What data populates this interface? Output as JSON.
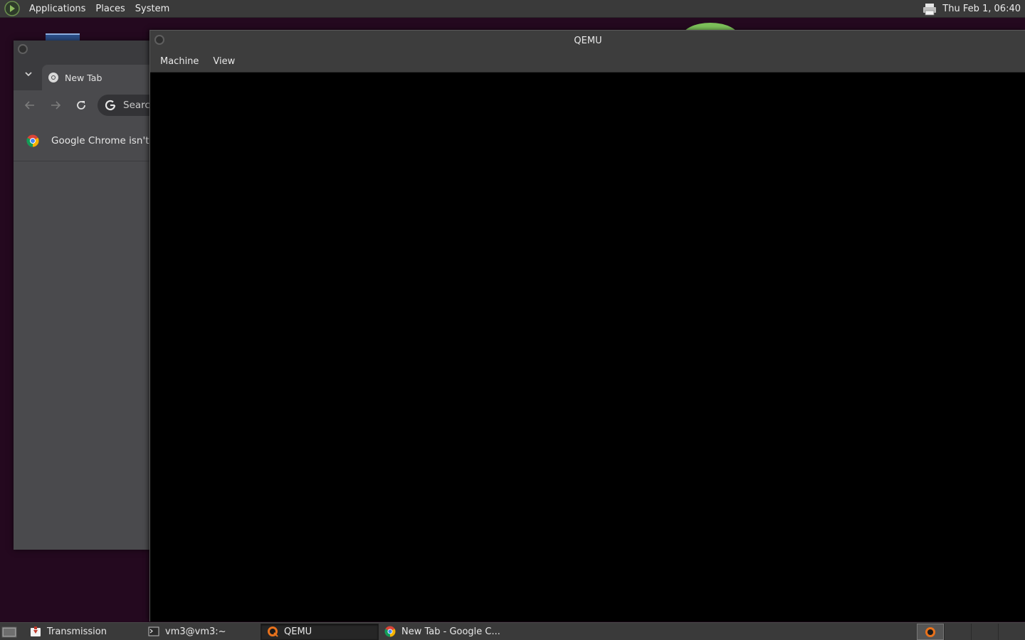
{
  "top_panel": {
    "logo_icon": "gnome-foot-icon",
    "menus": [
      "Applications",
      "Places",
      "System"
    ],
    "tray_icon": "printer-icon",
    "clock": "Thu Feb 1, 06:40"
  },
  "chrome_window": {
    "tab_title": "New Tab",
    "omnibox_text": "Search",
    "infobar_text": "Google Chrome isn't your default browser"
  },
  "qemu_window": {
    "title": "QEMU",
    "menus": [
      "Machine",
      "View"
    ]
  },
  "taskbar": {
    "items": [
      {
        "label": "Transmission",
        "icon": "transmission-icon",
        "active": false
      },
      {
        "label": "vm3@vm3:~",
        "icon": "terminal-icon",
        "active": false
      },
      {
        "label": "QEMU",
        "icon": "qemu-icon",
        "active": true
      },
      {
        "label": "New Tab - Google C...",
        "icon": "chrome-icon",
        "active": false
      }
    ]
  },
  "colors": {
    "desktop": "#24091f",
    "panel": "#3a3a3a",
    "qemu_screen": "#000000"
  }
}
